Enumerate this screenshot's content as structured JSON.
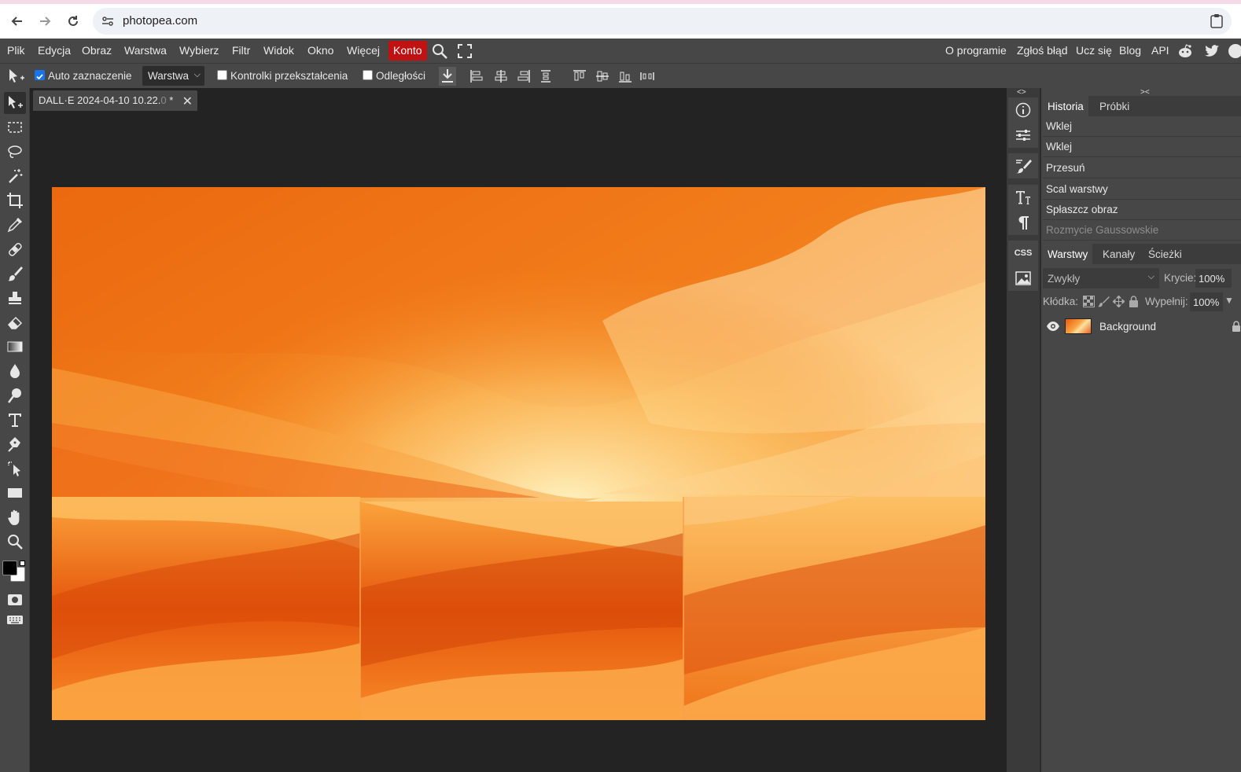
{
  "browser": {
    "url": "photopea.com"
  },
  "menu": {
    "items": [
      "Plik",
      "Edycja",
      "Obraz",
      "Warstwa",
      "Wybierz",
      "Filtr",
      "Widok",
      "Okno",
      "Więcej"
    ],
    "account": "Konto",
    "right": [
      "O programie",
      "Zgłoś błąd",
      "Ucz się",
      "Blog",
      "API"
    ]
  },
  "options": {
    "auto_select_label": "Auto zaznaczenie",
    "auto_select_checked": true,
    "target_select": "Warstwa",
    "transform_controls_label": "Kontrolki przekształcenia",
    "distances_label": "Odległości"
  },
  "document": {
    "tab_title": "DALL·E 2024-04-10 10.22.",
    "tab_modified_marker": "*"
  },
  "history_panel": {
    "tabs": [
      "Historia",
      "Próbki"
    ],
    "entries": [
      "Wklej",
      "Wklej",
      "Przesuń",
      "Scal warstwy",
      "Spłaszcz obraz",
      "Rozmycie Gaussowskie"
    ]
  },
  "layers_panel": {
    "tabs": [
      "Warstwy",
      "Kanały",
      "Ścieżki"
    ],
    "blend_mode": "Zwykły",
    "opacity_label": "Krycie:",
    "opacity_value": "100%",
    "lock_label": "Kłódka:",
    "fill_label": "Wypełnij:",
    "fill_value": "100%",
    "layers": [
      {
        "name": "Background",
        "visible": true,
        "locked": true
      }
    ]
  },
  "mini_panels": {
    "css_label": "CSS"
  },
  "colors": {
    "foreground": "#000000",
    "background": "#ffffff",
    "accent": "#c01212"
  }
}
